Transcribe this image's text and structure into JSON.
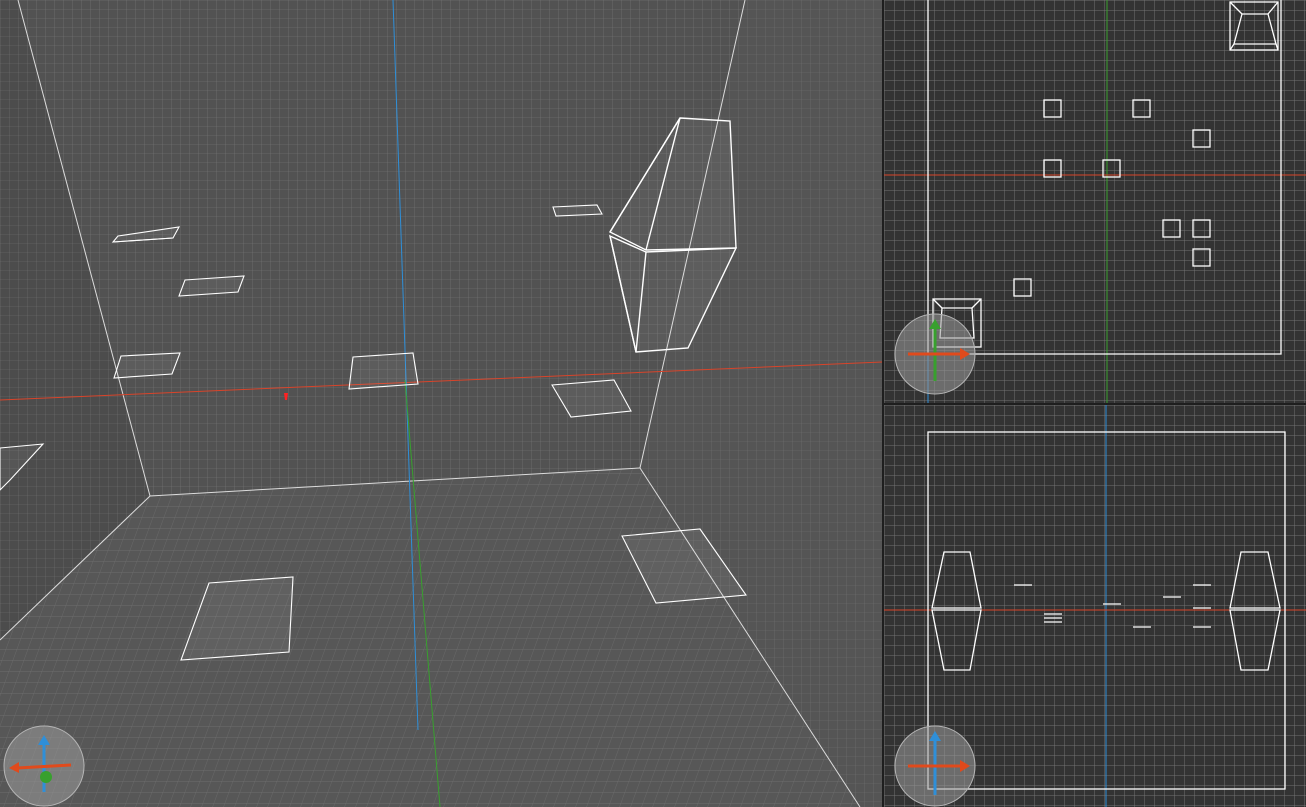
{
  "app": {
    "panes": [
      "viewport-3d",
      "viewport-top",
      "viewport-front"
    ]
  },
  "colors": {
    "viewport_3d_bg": "#505050",
    "ortho_bg": "#333333",
    "grid_line": "#6a6a6a",
    "wireframe": "#ffffff",
    "axis_x": "#d9442a",
    "axis_y": "#38a02e",
    "axis_z": "#2f8fd8",
    "gizmo_disc": "#9a9a9a"
  },
  "icons": {
    "perspective_gizmo": "orientation-gizmo-icon",
    "top_gizmo": "orientation-gizmo-icon",
    "front_gizmo": "orientation-gizmo-icon"
  }
}
